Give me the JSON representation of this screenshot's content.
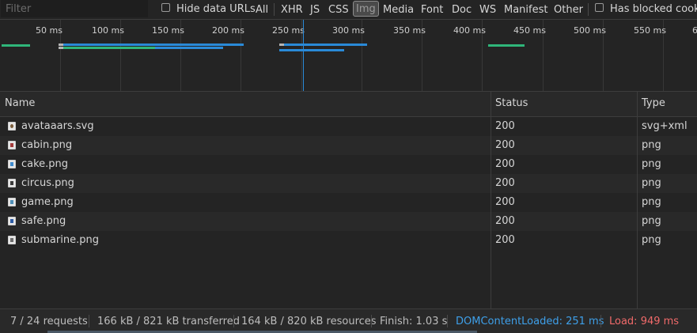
{
  "toolbar": {
    "filter_placeholder": "Filter",
    "hide_data_urls_label": "Hide data URLs",
    "types": [
      "All",
      "XHR",
      "JS",
      "CSS",
      "Img",
      "Media",
      "Font",
      "Doc",
      "WS",
      "Manifest",
      "Other"
    ],
    "active_type": "Img",
    "has_blocked_label": "Has blocked cookie"
  },
  "overview": {
    "ticks": [
      "50 ms",
      "100 ms",
      "150 ms",
      "200 ms",
      "250 ms",
      "300 ms",
      "350 ms",
      "400 ms",
      "450 ms",
      "500 ms",
      "550 ms",
      "6"
    ],
    "colors": {
      "green": "#2fb67a",
      "blue": "#2a8ad8",
      "gray": "#b5b5b5",
      "marker": "#2a8ad8"
    }
  },
  "columns": {
    "name": "Name",
    "status": "Status",
    "type": "Type"
  },
  "requests": [
    {
      "name": "avataaars.svg",
      "status": "200",
      "type": "svg+xml",
      "icon": "svg-file-icon"
    },
    {
      "name": "cabin.png",
      "status": "200",
      "type": "png",
      "icon": "image-file-icon"
    },
    {
      "name": "cake.png",
      "status": "200",
      "type": "png",
      "icon": "image-file-icon"
    },
    {
      "name": "circus.png",
      "status": "200",
      "type": "png",
      "icon": "image-file-icon"
    },
    {
      "name": "game.png",
      "status": "200",
      "type": "png",
      "icon": "image-file-icon"
    },
    {
      "name": "safe.png",
      "status": "200",
      "type": "png",
      "icon": "image-file-icon"
    },
    {
      "name": "submarine.png",
      "status": "200",
      "type": "png",
      "icon": "image-file-icon"
    }
  ],
  "statusbar": {
    "requests": "7 / 24 requests",
    "transferred": "166 kB / 821 kB transferred",
    "resources": "164 kB / 820 kB resources",
    "finish": "Finish: 1.03 s",
    "dom_content_loaded": "DOMContentLoaded: 251 ms",
    "load": "Load: 949 ms"
  }
}
